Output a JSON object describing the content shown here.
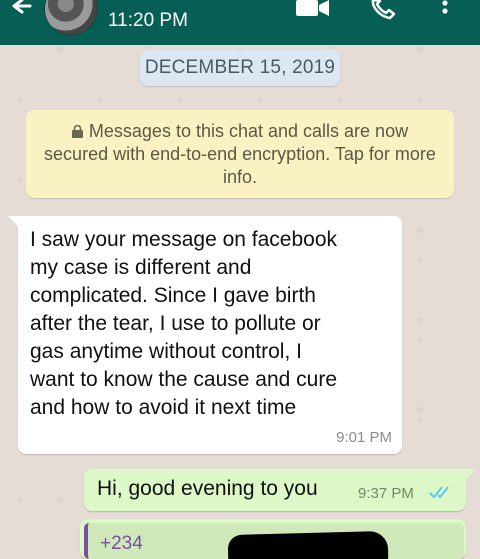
{
  "header": {
    "subtitle_time": "11:20 PM",
    "icons": [
      "back-arrow-icon",
      "contact-avatar",
      "video-call-icon",
      "voice-call-icon",
      "more-options-icon"
    ]
  },
  "chat": {
    "date_chip": "DECEMBER 15, 2019",
    "encryption_notice": "Messages to this chat and calls are now secured with end-to-end encryption. Tap for more info.",
    "messages": [
      {
        "direction": "incoming",
        "text": "I saw your message on facebook\nmy case is different and\ncomplicated. Since I gave birth\nafter the tear, I use to pollute or\ngas anytime without control, I\nwant to know the cause and cure\nand how to avoid it next time",
        "time": "9:01 PM"
      },
      {
        "direction": "outgoing",
        "text": "Hi, good evening to you",
        "time": "9:37 PM",
        "status": "read"
      },
      {
        "direction": "outgoing",
        "quoted_text": "+234"
      }
    ]
  },
  "colors": {
    "header_bg": "#075e54",
    "chat_bg": "#e5ddd5",
    "outgoing_bubble": "#dcf8c6",
    "incoming_bubble": "#ffffff",
    "date_chip_bg": "#dbe8f4",
    "encryption_bg": "#fbf2c4",
    "read_ticks": "#4fc3f7"
  }
}
